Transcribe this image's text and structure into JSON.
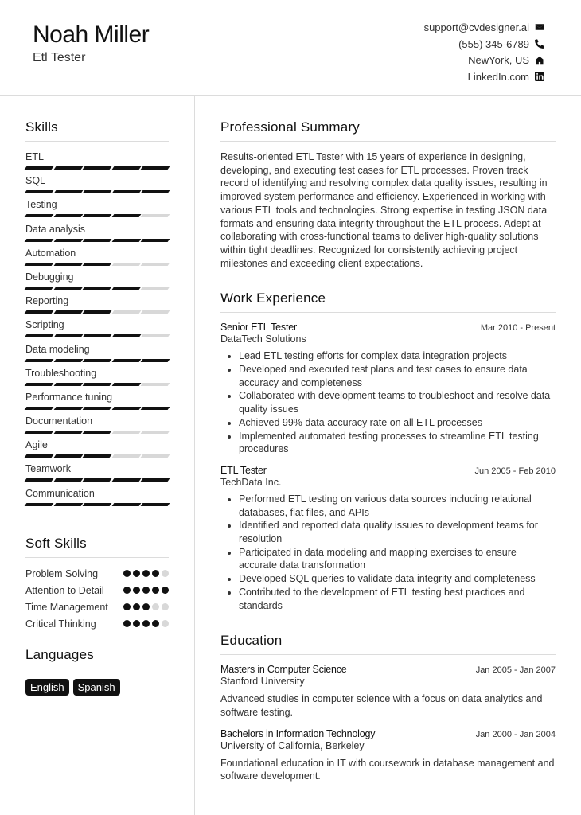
{
  "header": {
    "name": "Noah Miller",
    "title": "Etl Tester",
    "contacts": [
      {
        "text": "support@cvdesigner.ai",
        "icon": "envelope-icon"
      },
      {
        "text": "(555) 345-6789",
        "icon": "phone-icon"
      },
      {
        "text": "NewYork, US",
        "icon": "home-icon"
      },
      {
        "text": "LinkedIn.com",
        "icon": "linkedin-icon"
      }
    ]
  },
  "sidebar": {
    "skills_title": "Skills",
    "skills": [
      {
        "name": "ETL",
        "level": 5,
        "max": 5
      },
      {
        "name": "SQL",
        "level": 5,
        "max": 5
      },
      {
        "name": "Testing",
        "level": 4,
        "max": 5
      },
      {
        "name": "Data analysis",
        "level": 5,
        "max": 5
      },
      {
        "name": "Automation",
        "level": 3,
        "max": 5
      },
      {
        "name": "Debugging",
        "level": 4,
        "max": 5
      },
      {
        "name": "Reporting",
        "level": 3,
        "max": 5
      },
      {
        "name": "Scripting",
        "level": 4,
        "max": 5
      },
      {
        "name": "Data modeling",
        "level": 5,
        "max": 5
      },
      {
        "name": "Troubleshooting",
        "level": 4,
        "max": 5
      },
      {
        "name": "Performance tuning",
        "level": 5,
        "max": 5
      },
      {
        "name": "Documentation",
        "level": 3,
        "max": 5
      },
      {
        "name": "Agile",
        "level": 3,
        "max": 5
      },
      {
        "name": "Teamwork",
        "level": 5,
        "max": 5
      },
      {
        "name": "Communication",
        "level": 5,
        "max": 5
      }
    ],
    "soft_title": "Soft Skills",
    "soft_skills": [
      {
        "name": "Problem Solving",
        "level": 4,
        "max": 5
      },
      {
        "name": "Attention to Detail",
        "level": 5,
        "max": 5
      },
      {
        "name": "Time Management",
        "level": 3,
        "max": 5
      },
      {
        "name": "Critical Thinking",
        "level": 4,
        "max": 5
      }
    ],
    "languages_title": "Languages",
    "languages": [
      "English",
      "Spanish"
    ]
  },
  "main": {
    "summary_title": "Professional Summary",
    "summary": "Results-oriented ETL Tester with 15 years of experience in designing, developing, and executing test cases for ETL processes. Proven track record of identifying and resolving complex data quality issues, resulting in improved system performance and efficiency. Experienced in working with various ETL tools and technologies. Strong expertise in testing JSON data formats and ensuring data integrity throughout the ETL process. Adept at collaborating with cross-functional teams to deliver high-quality solutions within tight deadlines. Recognized for consistently achieving project milestones and exceeding client expectations.",
    "work_title": "Work Experience",
    "jobs": [
      {
        "role": "Senior ETL Tester",
        "date": "Mar 2010 - Present",
        "company": "DataTech Solutions",
        "bullets": [
          "Lead ETL testing efforts for complex data integration projects",
          "Developed and executed test plans and test cases to ensure data accuracy and completeness",
          "Collaborated with development teams to troubleshoot and resolve data quality issues",
          "Achieved 99% data accuracy rate on all ETL processes",
          "Implemented automated testing processes to streamline ETL testing procedures"
        ]
      },
      {
        "role": "ETL Tester",
        "date": "Jun 2005 - Feb 2010",
        "company": "TechData Inc.",
        "bullets": [
          "Performed ETL testing on various data sources including relational databases, flat files, and APIs",
          "Identified and reported data quality issues to development teams for resolution",
          "Participated in data modeling and mapping exercises to ensure accurate data transformation",
          "Developed SQL queries to validate data integrity and completeness",
          "Contributed to the development of ETL testing best practices and standards"
        ]
      }
    ],
    "education_title": "Education",
    "education": [
      {
        "degree": "Masters in Computer Science",
        "date": "Jan 2005 - Jan 2007",
        "school": "Stanford University",
        "desc": "Advanced studies in computer science with a focus on data analytics and software testing."
      },
      {
        "degree": "Bachelors in Information Technology",
        "date": "Jan 2000 - Jan 2004",
        "school": "University of California, Berkeley",
        "desc": "Foundational education in IT with coursework in database management and software development."
      }
    ]
  }
}
